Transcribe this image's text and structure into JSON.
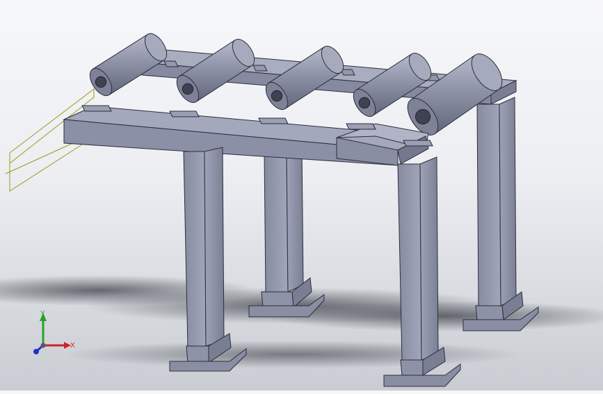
{
  "viewport": {
    "colors": {
      "background_top": "#f6f7f9",
      "background_bottom": "#c9ccd2",
      "steel_light": "#9fa4b8",
      "steel_mid": "#8a8fa4",
      "steel_dark": "#6c7086",
      "edge": "#2b2d3a",
      "shadow": "#3d4048",
      "sketch_line": "#9a9a18"
    },
    "model": {
      "roller_count": 5,
      "leg_count": 4
    }
  },
  "triad": {
    "x_label": "X",
    "y_label": "Y",
    "x_color": "#d0202a",
    "y_color": "#27a127",
    "z_color": "#2630c8"
  }
}
